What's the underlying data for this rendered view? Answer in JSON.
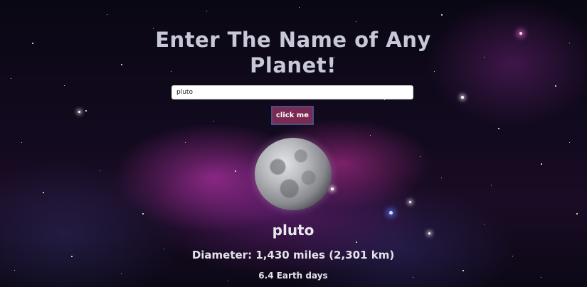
{
  "page": {
    "title": "Enter The Name of Any Planet!"
  },
  "search": {
    "value": "pluto",
    "button_label": "click me"
  },
  "result": {
    "planet_name": "pluto",
    "diameter": "Diameter: 1,430 miles (2,301 km)",
    "day_length": "6.4 Earth days"
  },
  "colors": {
    "title": "#c7c9d8",
    "button_bg": "#7a2b52",
    "button_border": "#4a4f8a"
  }
}
